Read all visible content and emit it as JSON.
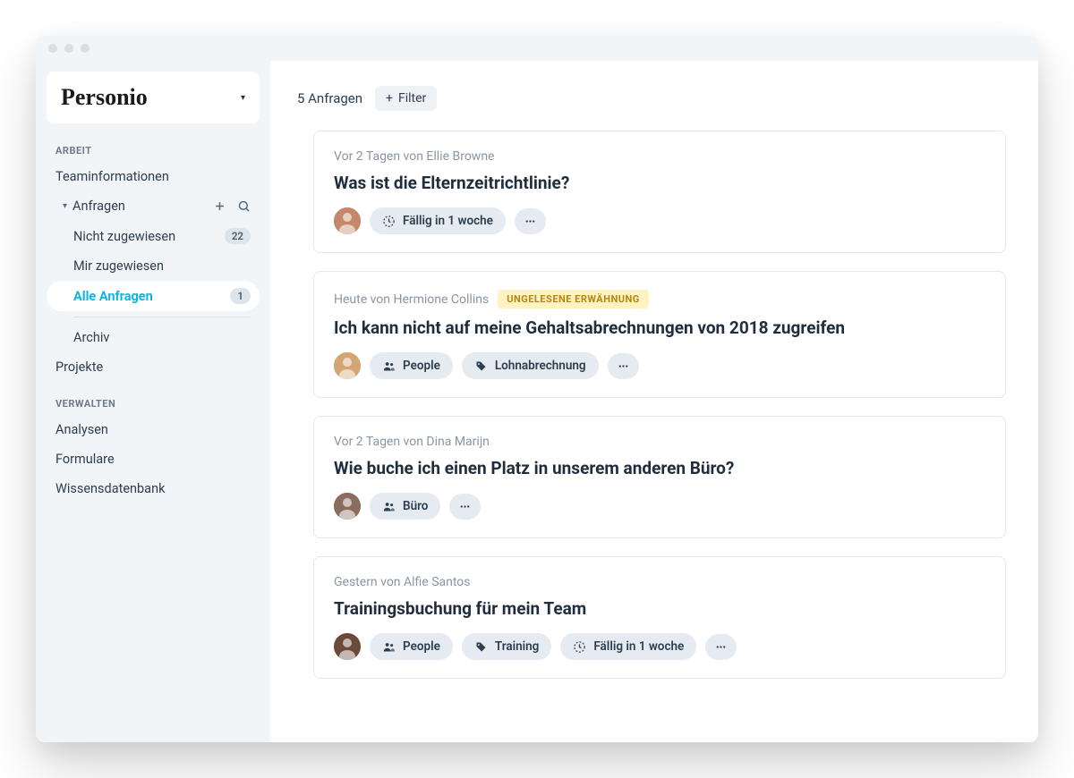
{
  "brand": "Personio",
  "sidebar": {
    "sections": [
      {
        "label": "ARBEIT",
        "items": [
          {
            "label": "Teaminformationen"
          },
          {
            "label": "Anfragen",
            "expandable": true,
            "children": [
              {
                "label": "Nicht zugewiesen",
                "badge": "22"
              },
              {
                "label": "Mir zugewiesen"
              },
              {
                "label": "Alle Anfragen",
                "badge": "1",
                "active": true
              },
              {
                "label": "Archiv",
                "divider_before": true
              }
            ]
          },
          {
            "label": "Projekte"
          }
        ]
      },
      {
        "label": "VERWALTEN",
        "items": [
          {
            "label": "Analysen"
          },
          {
            "label": "Formulare"
          },
          {
            "label": "Wissensdatenbank"
          }
        ]
      }
    ]
  },
  "toolbar": {
    "count": "5 Anfragen",
    "filter": "Filter"
  },
  "mention_badge": "UNGELESENE ERWÄHNUNG",
  "cards": [
    {
      "meta": "Vor 2 Tagen von Ellie Browne",
      "title": "Was ist die Elternzeitrichtlinie?",
      "avatar_color": "#c4876a",
      "tags": [
        {
          "icon": "clock",
          "label": "Fällig in 1 woche"
        }
      ]
    },
    {
      "meta": "Heute von Hermione Collins",
      "mention": true,
      "title": "Ich kann nicht auf meine Gehaltsabrechnungen von 2018 zugreifen",
      "avatar_color": "#d4a574",
      "tags": [
        {
          "icon": "people",
          "label": "People"
        },
        {
          "icon": "tag",
          "label": "Lohnabrechnung"
        }
      ]
    },
    {
      "meta": "Vor 2 Tagen von Dina Marijn",
      "title": "Wie buche ich einen Platz in unserem anderen Büro?",
      "avatar_color": "#8a6d5c",
      "tags": [
        {
          "icon": "people",
          "label": "Büro"
        }
      ]
    },
    {
      "meta": "Gestern von Alfie Santos",
      "title": "Trainingsbuchung für mein Team",
      "avatar_color": "#6b4a3a",
      "tags": [
        {
          "icon": "people",
          "label": "People"
        },
        {
          "icon": "tag",
          "label": "Training"
        },
        {
          "icon": "clock",
          "label": "Fällig in 1 woche"
        }
      ]
    }
  ]
}
